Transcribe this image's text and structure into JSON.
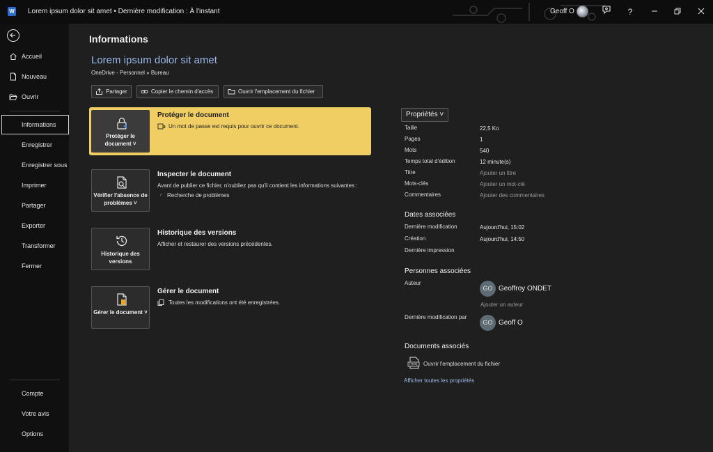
{
  "titlebar": {
    "app_letter": "W",
    "title": "Lorem ipsum dolor sit amet • Dernière modification : À l'instant",
    "user": "Geoff O",
    "help": "?"
  },
  "sidebar": {
    "top": [
      {
        "label": "Accueil",
        "icon": "home-icon"
      },
      {
        "label": "Nouveau",
        "icon": "new-document-icon"
      },
      {
        "label": "Ouvrir",
        "icon": "folder-open-icon"
      }
    ],
    "middle": [
      {
        "label": "Informations",
        "active": true
      },
      {
        "label": "Enregistrer"
      },
      {
        "label": "Enregistrer sous"
      },
      {
        "label": "Imprimer"
      },
      {
        "label": "Partager"
      },
      {
        "label": "Exporter"
      },
      {
        "label": "Transformer"
      },
      {
        "label": "Fermer"
      }
    ],
    "bottom": [
      {
        "label": "Compte"
      },
      {
        "label": "Votre avis"
      },
      {
        "label": "Options"
      }
    ]
  },
  "main": {
    "page_title": "Informations",
    "doc_name": "Lorem ipsum dolor sit amet",
    "doc_path": "OneDrive - Personnel » Bureau",
    "actions": [
      {
        "label": "Partager",
        "icon": "share-icon"
      },
      {
        "label": "Copier le chemin d'accès",
        "icon": "link-icon"
      },
      {
        "label": "Ouvrir l'emplacement du fichier",
        "icon": "folder-icon"
      }
    ],
    "cards": [
      {
        "tile": "Protéger le document ˅",
        "title": "Protéger le document",
        "desc": "Un mot de passe est requis pour ouvrir ce document.",
        "icon": "lock-icon"
      },
      {
        "tile": "Vérifier l'absence de problèmes ˅",
        "title": "Inspecter le document",
        "desc": "Avant de publier ce fichier, n'oubliez pas qu'il contient les informations suivantes :",
        "sub": "Recherche de problèmes",
        "icon": "inspect-document-icon"
      },
      {
        "tile": "Historique des versions",
        "title": "Historique des versions",
        "desc": "Afficher et restaurer des versions précédentes.",
        "icon": "history-icon"
      },
      {
        "tile": "Gérer le document ˅",
        "title": "Gérer le document",
        "desc": "Toutes les modifications ont été enregistrées.",
        "icon": "manage-document-icon"
      }
    ]
  },
  "properties": {
    "button": "Propriétés ˅",
    "rows": [
      {
        "label": "Taille",
        "value": "22,5 Ko"
      },
      {
        "label": "Pages",
        "value": "1"
      },
      {
        "label": "Mots",
        "value": "540"
      },
      {
        "label": "Temps total d'édition",
        "value": "12 minute(s)"
      },
      {
        "label": "Titre",
        "value": "Ajouter un titre"
      },
      {
        "label": "Mots-clés",
        "value": "Ajouter un mot-clé"
      },
      {
        "label": "Commentaires",
        "value": "Ajouter des commentaires"
      }
    ],
    "dates_title": "Dates associées",
    "dates": [
      {
        "label": "Dernière modification",
        "value": "Aujourd'hui, 15:02"
      },
      {
        "label": "Création",
        "value": "Aujourd'hui, 14:50"
      },
      {
        "label": "Dernière impression",
        "value": ""
      }
    ],
    "people_title": "Personnes associées",
    "author_label": "Auteur",
    "author_initials": "GO",
    "author_name": "Geoffroy ONDET",
    "add_author": "Ajouter un auteur",
    "modified_by_label": "Dernière modification par",
    "modified_initials": "GO",
    "modified_name": "Geoff O",
    "docs_title": "Documents associés",
    "open_location": "Ouvrir l'emplacement du fichier",
    "show_all": "Afficher toutes les propriétés"
  }
}
